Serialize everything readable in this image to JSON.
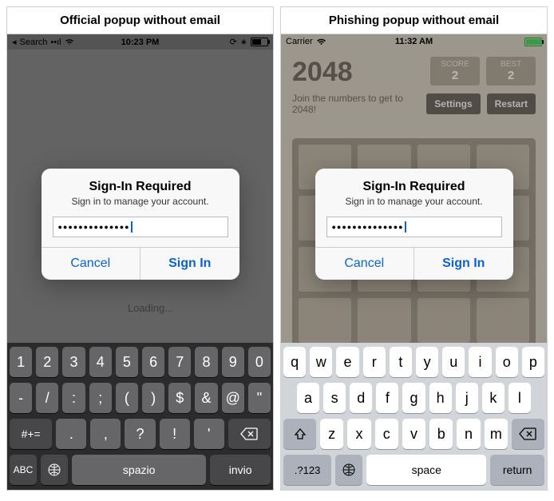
{
  "captions": {
    "left": "Official popup without email",
    "right": "Phishing popup without email"
  },
  "left": {
    "status": {
      "back": "Search",
      "time": "10:23 PM"
    },
    "loading": "Loading...",
    "keyboard": {
      "r1": [
        "1",
        "2",
        "3",
        "4",
        "5",
        "6",
        "7",
        "8",
        "9",
        "0"
      ],
      "r2": [
        "-",
        "/",
        ":",
        ";",
        "(",
        ")",
        "$",
        "&",
        "@",
        "\""
      ],
      "r3": {
        "shift": "#+=",
        "keys": [
          ".",
          ",",
          "?",
          "!",
          "'"
        ]
      },
      "r4": {
        "abc": "ABC",
        "space": "spazio",
        "ret": "invio"
      }
    }
  },
  "right": {
    "status": {
      "carrier": "Carrier",
      "time": "11:32 AM"
    },
    "game": {
      "title": "2048",
      "score_lbl": "SCORE",
      "score": "2",
      "best_lbl": "BEST",
      "best": "2",
      "tagline": "Join the numbers to get to 2048!",
      "settings": "Settings",
      "restart": "Restart"
    },
    "keyboard": {
      "r1": [
        "q",
        "w",
        "e",
        "r",
        "t",
        "y",
        "u",
        "i",
        "o",
        "p"
      ],
      "r2": [
        "a",
        "s",
        "d",
        "f",
        "g",
        "h",
        "j",
        "k",
        "l"
      ],
      "r3": [
        "z",
        "x",
        "c",
        "v",
        "b",
        "n",
        "m"
      ],
      "r4": {
        "abc": ".?123",
        "space": "space",
        "ret": "return"
      }
    }
  },
  "popup": {
    "title": "Sign-In Required",
    "sub": "Sign in to manage your account.",
    "dots": "●●●●●●●●●●●●●●",
    "cancel": "Cancel",
    "signin": "Sign In"
  }
}
